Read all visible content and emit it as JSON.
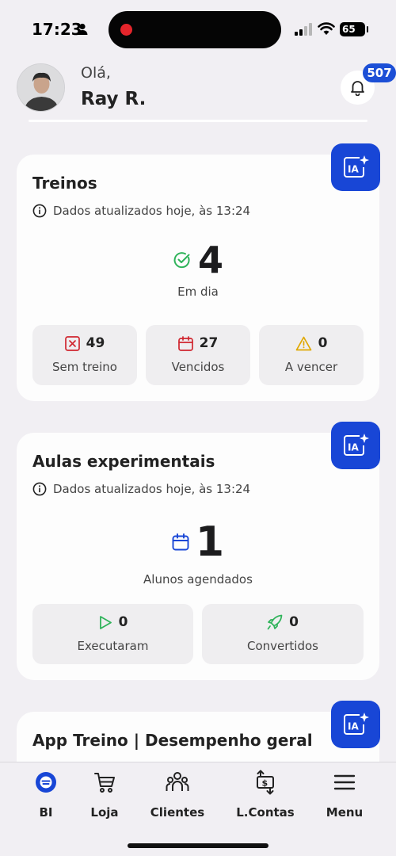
{
  "status_bar": {
    "time": "17:23",
    "battery": "65"
  },
  "header": {
    "greeting": "Olá,",
    "user_name": "Ray R.",
    "notification_count": "507"
  },
  "cards": {
    "treinos": {
      "title": "Treinos",
      "updated": "Dados atualizados hoje, às 13:24",
      "main_value": "4",
      "main_label": "Em dia",
      "stats": [
        {
          "value": "49",
          "label": "Sem treino"
        },
        {
          "value": "27",
          "label": "Vencidos"
        },
        {
          "value": "0",
          "label": "A vencer"
        }
      ]
    },
    "aulas": {
      "title": "Aulas experimentais",
      "updated": "Dados atualizados hoje, às 13:24",
      "main_value": "1",
      "main_label": "Alunos agendados",
      "stats": [
        {
          "value": "0",
          "label": "Executaram"
        },
        {
          "value": "0",
          "label": "Convertidos"
        }
      ]
    },
    "app_treino": {
      "title": "App Treino | Desempenho geral"
    }
  },
  "ia_label": "IA",
  "nav": [
    {
      "label": "BI"
    },
    {
      "label": "Loja"
    },
    {
      "label": "Clientes"
    },
    {
      "label": "L.Contas"
    },
    {
      "label": "Menu"
    }
  ],
  "colors": {
    "accent": "#1846d6",
    "success": "#2fb35a",
    "danger": "#d0262f",
    "warning": "#e0a800"
  }
}
